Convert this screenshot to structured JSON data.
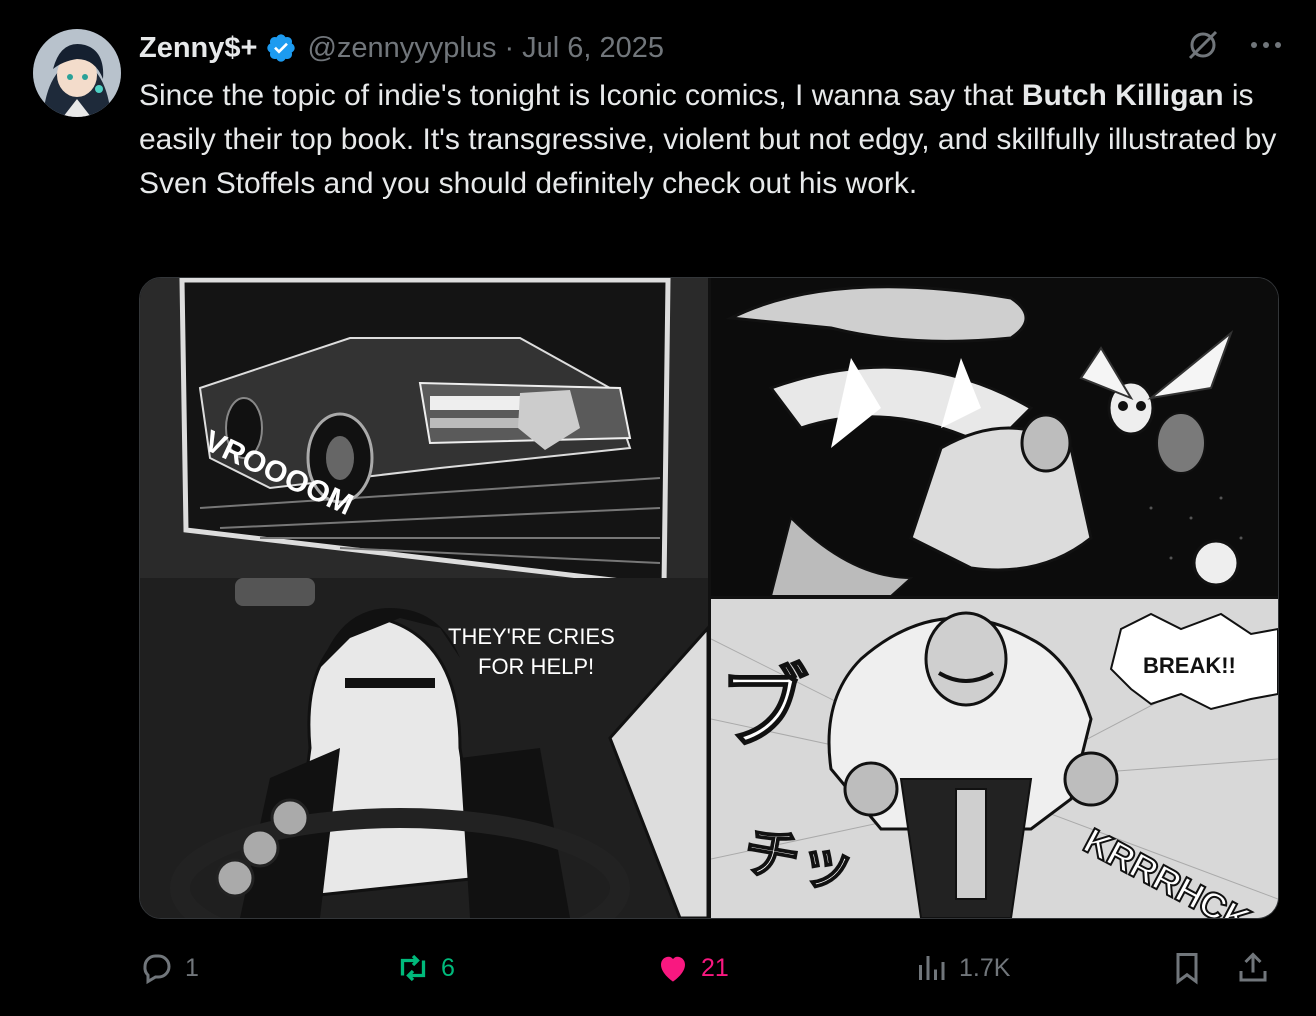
{
  "author": {
    "display_name": "Zenny$+",
    "handle": "@zennyyyplus",
    "separator": "·",
    "date": "Jul 6, 2025",
    "verified": true,
    "avatar_icon": "avatar-anime-character"
  },
  "tweet": {
    "text_part1": "Since the topic of indie's tonight is Iconic comics, I wanna say that ",
    "bold_part1": "Butch Killigan",
    "text_part2": " is easily their top book. It's transgressive, violent but not edgy, and skillfully illustrated by Sven Stoffels and you should definitely check out his work."
  },
  "media": {
    "panel1": {
      "sfx": "VROOOOM",
      "speech": [
        "THEY'RE CRIES",
        "FOR HELP!"
      ]
    },
    "panel2": {},
    "panel3": {
      "sfx_jp_1": "ブ",
      "sfx_jp_2": "チッ",
      "speech": "BREAK!!",
      "sfx": "KRRRHCK"
    }
  },
  "actions": {
    "replies": "1",
    "reposts": "6",
    "likes": "21",
    "views": "1.7K"
  },
  "colors": {
    "background": "#000000",
    "text": "#e7e9ea",
    "muted": "#71767b",
    "verified": "#1d9bf0",
    "repost": "#00ba7c",
    "like": "#f91880"
  }
}
